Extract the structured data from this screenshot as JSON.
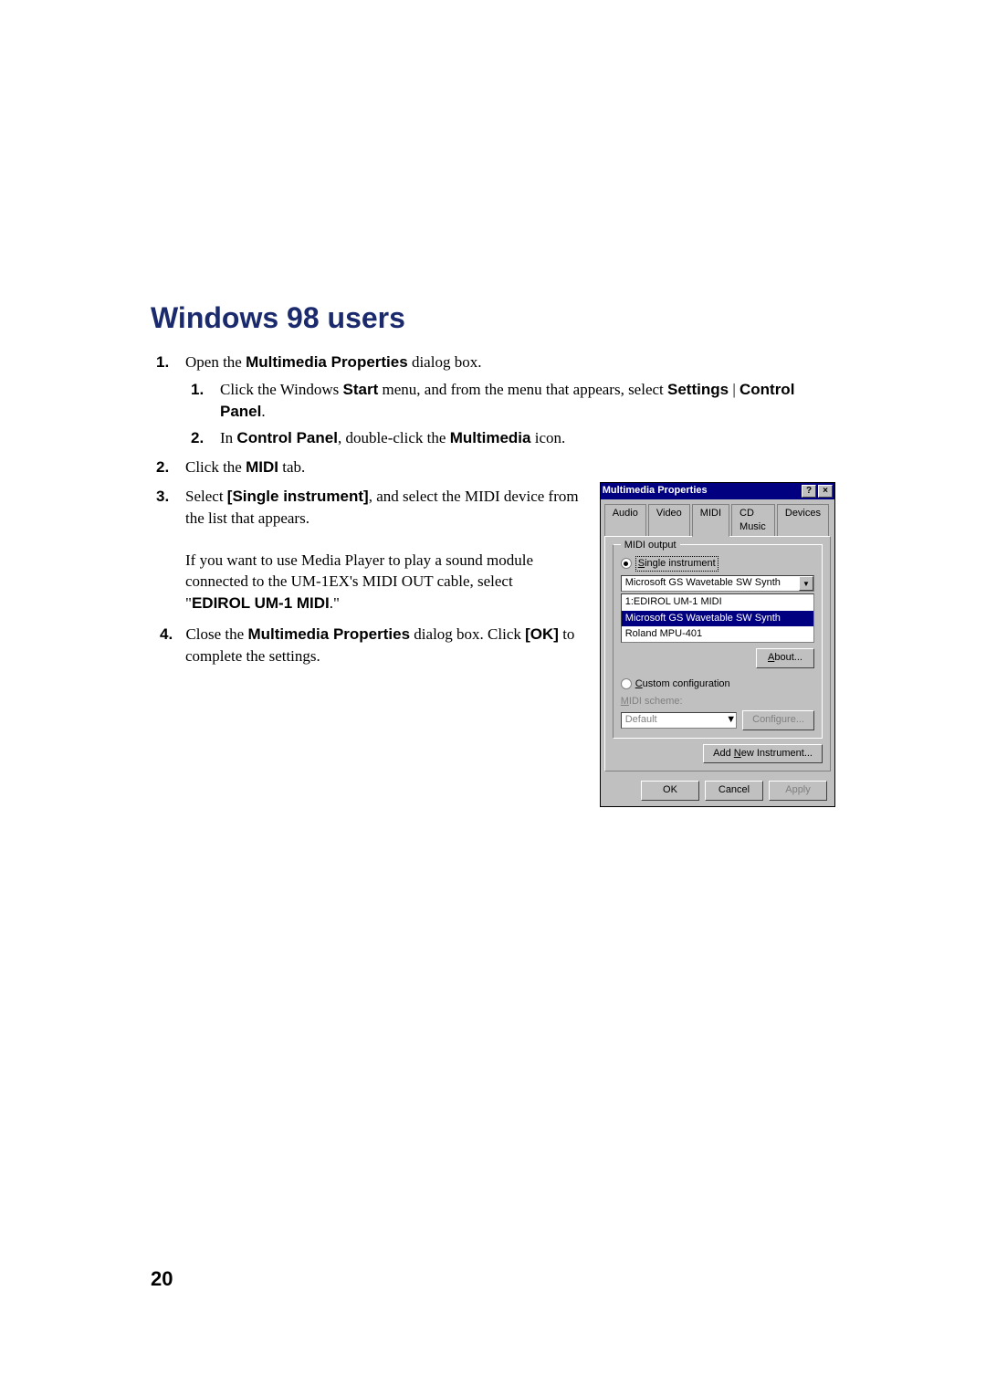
{
  "heading": "Windows 98 users",
  "page_number": "20",
  "steps": {
    "s1": {
      "prefix": "Open the ",
      "bold1": "Multimedia Properties",
      "suffix": " dialog box.",
      "sub1": {
        "t1": "Click the Windows ",
        "b1": "Start",
        "t2": " menu, and from the menu that appears, select ",
        "b2": "Settings",
        "t3": " | ",
        "b3": "Control Panel",
        "t4": "."
      },
      "sub2": {
        "t1": "In ",
        "b1": "Control Panel",
        "t2": ", double-click the ",
        "b2": "Multimedia",
        "t3": " icon."
      }
    },
    "s2": {
      "t1": "Click the ",
      "b1": "MIDI",
      "t2": " tab."
    },
    "s3": {
      "t1": "Select ",
      "b1": "[Single instrument]",
      "t2": ", and select the MIDI device from the list that appears.",
      "p2a": "If you want to use Media Player to play a sound module connected to the UM-1EX's MIDI OUT cable, select \"",
      "p2b": "EDIROL UM-1 MIDI",
      "p2c": ".\""
    },
    "s4": {
      "t1": "Close the ",
      "b1": "Multimedia Properties",
      "t2": " dialog box. Click ",
      "b2": "[OK]",
      "t3": " to complete the settings."
    }
  },
  "dialog": {
    "title": "Multimedia Properties",
    "help": "?",
    "close": "×",
    "tabs": {
      "audio": "Audio",
      "video": "Video",
      "midi": "MIDI",
      "cdmusic": "CD Music",
      "devices": "Devices"
    },
    "group_label": "MIDI output",
    "radio_single_s": "S",
    "radio_single_rest": "ingle instrument",
    "combo_value": "Microsoft GS Wavetable SW Synth",
    "list": {
      "i0": "1:EDIROL UM-1 MIDI",
      "i1": "Microsoft GS Wavetable SW Synth",
      "i2": "Roland MPU-401"
    },
    "about_a": "A",
    "about_rest": "bout...",
    "radio_custom_c": "C",
    "radio_custom_rest": "ustom configuration",
    "scheme_label_m": "M",
    "scheme_label_rest": "IDI scheme:",
    "scheme_value": "Default",
    "configure": "Configure...",
    "add_new_pre": "Add ",
    "add_new_n": "N",
    "add_new_rest": "ew Instrument...",
    "ok": "OK",
    "cancel": "Cancel",
    "apply": "Apply"
  }
}
